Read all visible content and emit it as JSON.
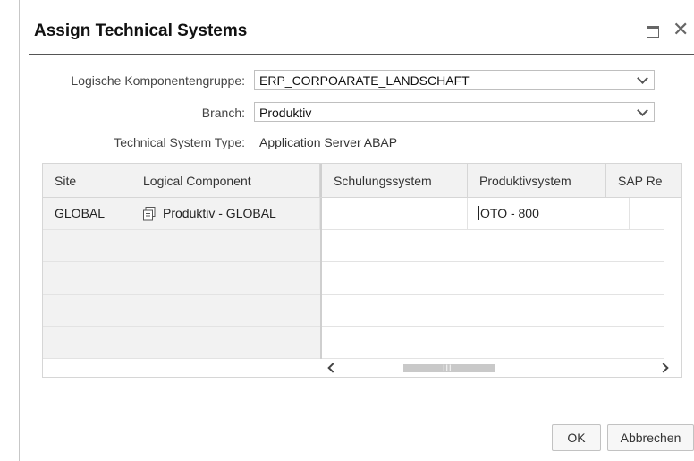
{
  "dialog": {
    "title": "Assign Technical Systems"
  },
  "form": {
    "group_label": "Logische Komponentengruppe:",
    "group_value": "ERP_CORPOARATE_LANDSCHAFT",
    "branch_label": "Branch:",
    "branch_value": "Produktiv",
    "type_label": "Technical System Type:",
    "type_value": "Application Server ABAP"
  },
  "table": {
    "columns": [
      "Site",
      "Logical Component",
      "Schulungssystem",
      "Produktivsystem",
      "SAP Re"
    ],
    "rows": [
      {
        "site": "GLOBAL",
        "logical_component": "Produktiv - GLOBAL",
        "schulungssystem": "",
        "produktivsystem": "OTO - 800",
        "sap_re": ""
      }
    ],
    "hscroll_grip": "III"
  },
  "buttons": {
    "ok": "OK",
    "cancel": "Abbrechen"
  },
  "icons": {
    "maximize": "maximize-icon",
    "close": "close-icon",
    "component": "logical-component-icon",
    "value_help": "copy-icon"
  }
}
